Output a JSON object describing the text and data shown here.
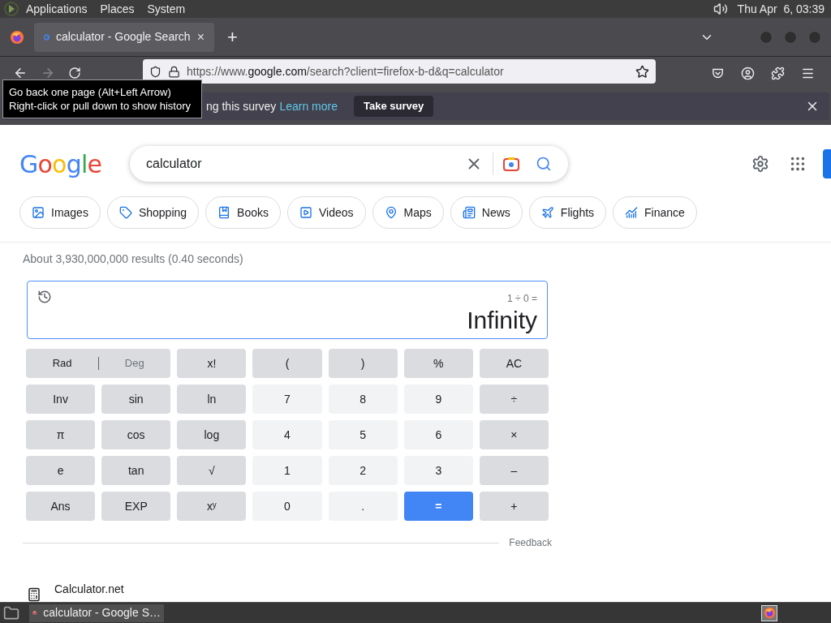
{
  "top_panel": {
    "menus": [
      "Applications",
      "Places",
      "System"
    ],
    "clock": "Thu Apr  6, 03:39"
  },
  "browser": {
    "tab": {
      "title": "calculator - Google Search",
      "close": "×",
      "selected": true
    },
    "new_tab": "+",
    "url": {
      "prefix": "https://www.",
      "domain": "google.com",
      "rest": "/search?client=firefox-b-d&q=calculator"
    },
    "tooltip": [
      "Go back one page (Alt+Left Arrow)",
      "Right-click or pull down to show history"
    ],
    "notification": {
      "text": "ng this survey",
      "link": "Learn more",
      "button": "Take survey"
    }
  },
  "google": {
    "logo": "Google",
    "query": "calculator",
    "chips": [
      {
        "label": "Images"
      },
      {
        "label": "Shopping"
      },
      {
        "label": "Books"
      },
      {
        "label": "Videos"
      },
      {
        "label": "Maps"
      },
      {
        "label": "News"
      },
      {
        "label": "Flights"
      },
      {
        "label": "Finance"
      }
    ],
    "stats": "About 3,930,000,000 results (0.40 seconds)"
  },
  "calculator": {
    "expression": "1 ÷ 0 =",
    "result": "Infinity",
    "rows": [
      [
        {
          "kind": "mode",
          "label": "Rad",
          "selected": true
        },
        {
          "kind": "mode",
          "label": "Deg",
          "selected": false
        },
        {
          "kind": "fn",
          "label": "x!"
        },
        {
          "kind": "fn",
          "label": "("
        },
        {
          "kind": "fn",
          "label": ")"
        },
        {
          "kind": "fn",
          "label": "%"
        },
        {
          "kind": "fn",
          "label": "AC"
        }
      ],
      [
        {
          "kind": "fn",
          "label": "Inv"
        },
        {
          "kind": "fn",
          "label": "sin"
        },
        {
          "kind": "fn",
          "label": "ln"
        },
        {
          "kind": "num",
          "label": "7"
        },
        {
          "kind": "num",
          "label": "8"
        },
        {
          "kind": "num",
          "label": "9"
        },
        {
          "kind": "fn",
          "label": "÷"
        }
      ],
      [
        {
          "kind": "fn",
          "label": "π"
        },
        {
          "kind": "fn",
          "label": "cos"
        },
        {
          "kind": "fn",
          "label": "log"
        },
        {
          "kind": "num",
          "label": "4"
        },
        {
          "kind": "num",
          "label": "5"
        },
        {
          "kind": "num",
          "label": "6"
        },
        {
          "kind": "fn",
          "label": "×"
        }
      ],
      [
        {
          "kind": "fn",
          "label": "e"
        },
        {
          "kind": "fn",
          "label": "tan"
        },
        {
          "kind": "fn",
          "label": "√"
        },
        {
          "kind": "num",
          "label": "1"
        },
        {
          "kind": "num",
          "label": "2"
        },
        {
          "kind": "num",
          "label": "3"
        },
        {
          "kind": "fn",
          "label": "–"
        }
      ],
      [
        {
          "kind": "fn",
          "label": "Ans"
        },
        {
          "kind": "fn",
          "label": "EXP"
        },
        {
          "kind": "fn",
          "label": "xʸ"
        },
        {
          "kind": "num",
          "label": "0"
        },
        {
          "kind": "num",
          "label": "."
        },
        {
          "kind": "equals",
          "label": "="
        },
        {
          "kind": "fn",
          "label": "+"
        }
      ]
    ],
    "feedback": "Feedback"
  },
  "result": {
    "title": "Calculator.net"
  },
  "taskbar": {
    "window": "calculator - Google S…"
  }
}
